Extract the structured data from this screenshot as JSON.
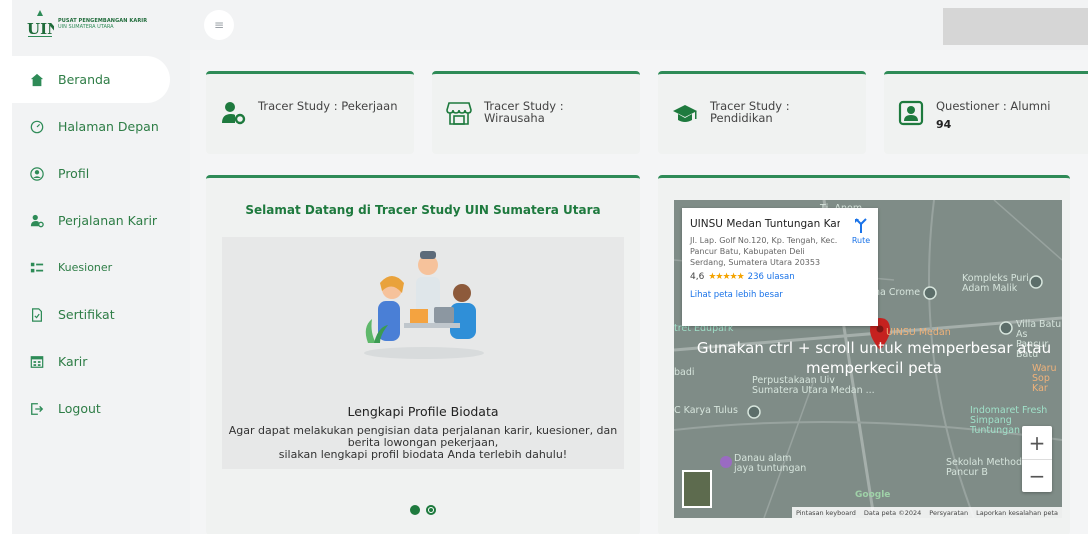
{
  "brand": {
    "title": "PUSAT PENGEMBANGAN KARIR",
    "subtitle": "UIN SUMATERA UTARA"
  },
  "sidebar": {
    "items": [
      {
        "label": "Beranda",
        "icon": "home-icon",
        "active": true
      },
      {
        "label": "Halaman Depan",
        "icon": "dashboard-icon"
      },
      {
        "label": "Profil",
        "icon": "user-circle-icon"
      },
      {
        "label": "Perjalanan Karir",
        "icon": "user-gear-icon"
      },
      {
        "label": "Kuesioner",
        "icon": "list-icon"
      },
      {
        "label": "Sertifikat",
        "icon": "file-check-icon"
      },
      {
        "label": "Karir",
        "icon": "calendar-icon"
      },
      {
        "label": "Logout",
        "icon": "logout-icon"
      }
    ]
  },
  "topbar": {
    "menu_icon": "hamburger-icon"
  },
  "stats": [
    {
      "label": "Tracer Study : Pekerjaan",
      "value": "",
      "icon": "user-gear-icon"
    },
    {
      "label": "Tracer Study :\nWirausaha",
      "value": "",
      "icon": "store-icon"
    },
    {
      "label": "Tracer Study :\nPendidikan",
      "value": "",
      "icon": "graduation-cap-icon"
    },
    {
      "label": "Questioner : Alumni",
      "value": "94",
      "icon": "portrait-icon"
    }
  ],
  "welcome": {
    "title": "Selamat Datang di Tracer Study UIN Sumatera Utara",
    "slide_heading": "Lengkapi Profile Biodata",
    "slide_desc": "Agar dapat melakukan pengisian data perjalanan karir, kuesioner, dan\nberita lowongan pekerjaan,\nsilakan lengkapi profil biodata Anda terlebih dahulu!"
  },
  "map": {
    "place_name": "UINSU Medan Tuntungan Kam...",
    "address": "Jl. Lap. Golf No.120, Kp. Tengah, Kec.\nPancur Batu, Kabupaten Deli\nSerdang, Sumatera Utara 20353",
    "rating": "4,6",
    "stars": "★★★★★",
    "reviews": "236 ulasan",
    "route_label": "Rute",
    "bigger_map": "Lihat peta lebih besar",
    "ctrl_hint": "Gunakan ctrl + scroll untuk memperbesar atau\nmemperkecil peta",
    "zoom_in": "+",
    "zoom_out": "−",
    "google": "Google",
    "labels": {
      "komplek": "Kompleks Puri\nAdam Malik",
      "villa": "Villa Batu As\nPancur Batu",
      "crome": "na Crome",
      "edupark": "tret Edupark",
      "perpus": "Perpustakaan Uiv\nSumatera Utara Medan ...",
      "bad": "badi",
      "waru": "Waru\nSop Kar",
      "karya": "C Karya Tulus",
      "indomaret": "Indomaret Fresh\nSimpang Tuntungan",
      "danau": "Danau alam\njaya tuntungan",
      "sekolah": "Sekolah Methodist\nPancur B",
      "uinsu": "UINSU Medan",
      "road": "Tj. Anom"
    },
    "attribution": [
      "Pintasan keyboard",
      "Data peta ©2024",
      "Persyaratan",
      "Laporkan kesalahan peta"
    ]
  }
}
